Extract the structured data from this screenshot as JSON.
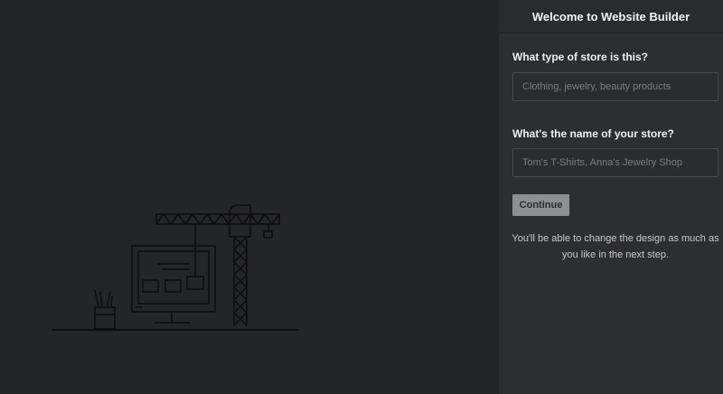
{
  "header": {
    "title": "Welcome to Website Builder"
  },
  "form": {
    "store_type": {
      "label": "What type of store is this?",
      "placeholder": "Clothing, jewelry, beauty products",
      "value": ""
    },
    "store_name": {
      "label": "What's the name of your store?",
      "placeholder": "Tom's T-Shirts, Anna's Jewelry Shop",
      "value": ""
    },
    "continue_label": "Continue",
    "note": "You'll be able to change the design as much as you like in the next step."
  },
  "illustration": {
    "icon": "construction-crane-monitor-illustration"
  },
  "colors": {
    "background": "#242528",
    "panel": "#2d2e32",
    "button": "#8e8f93",
    "line_art": "#0d0d0e"
  }
}
